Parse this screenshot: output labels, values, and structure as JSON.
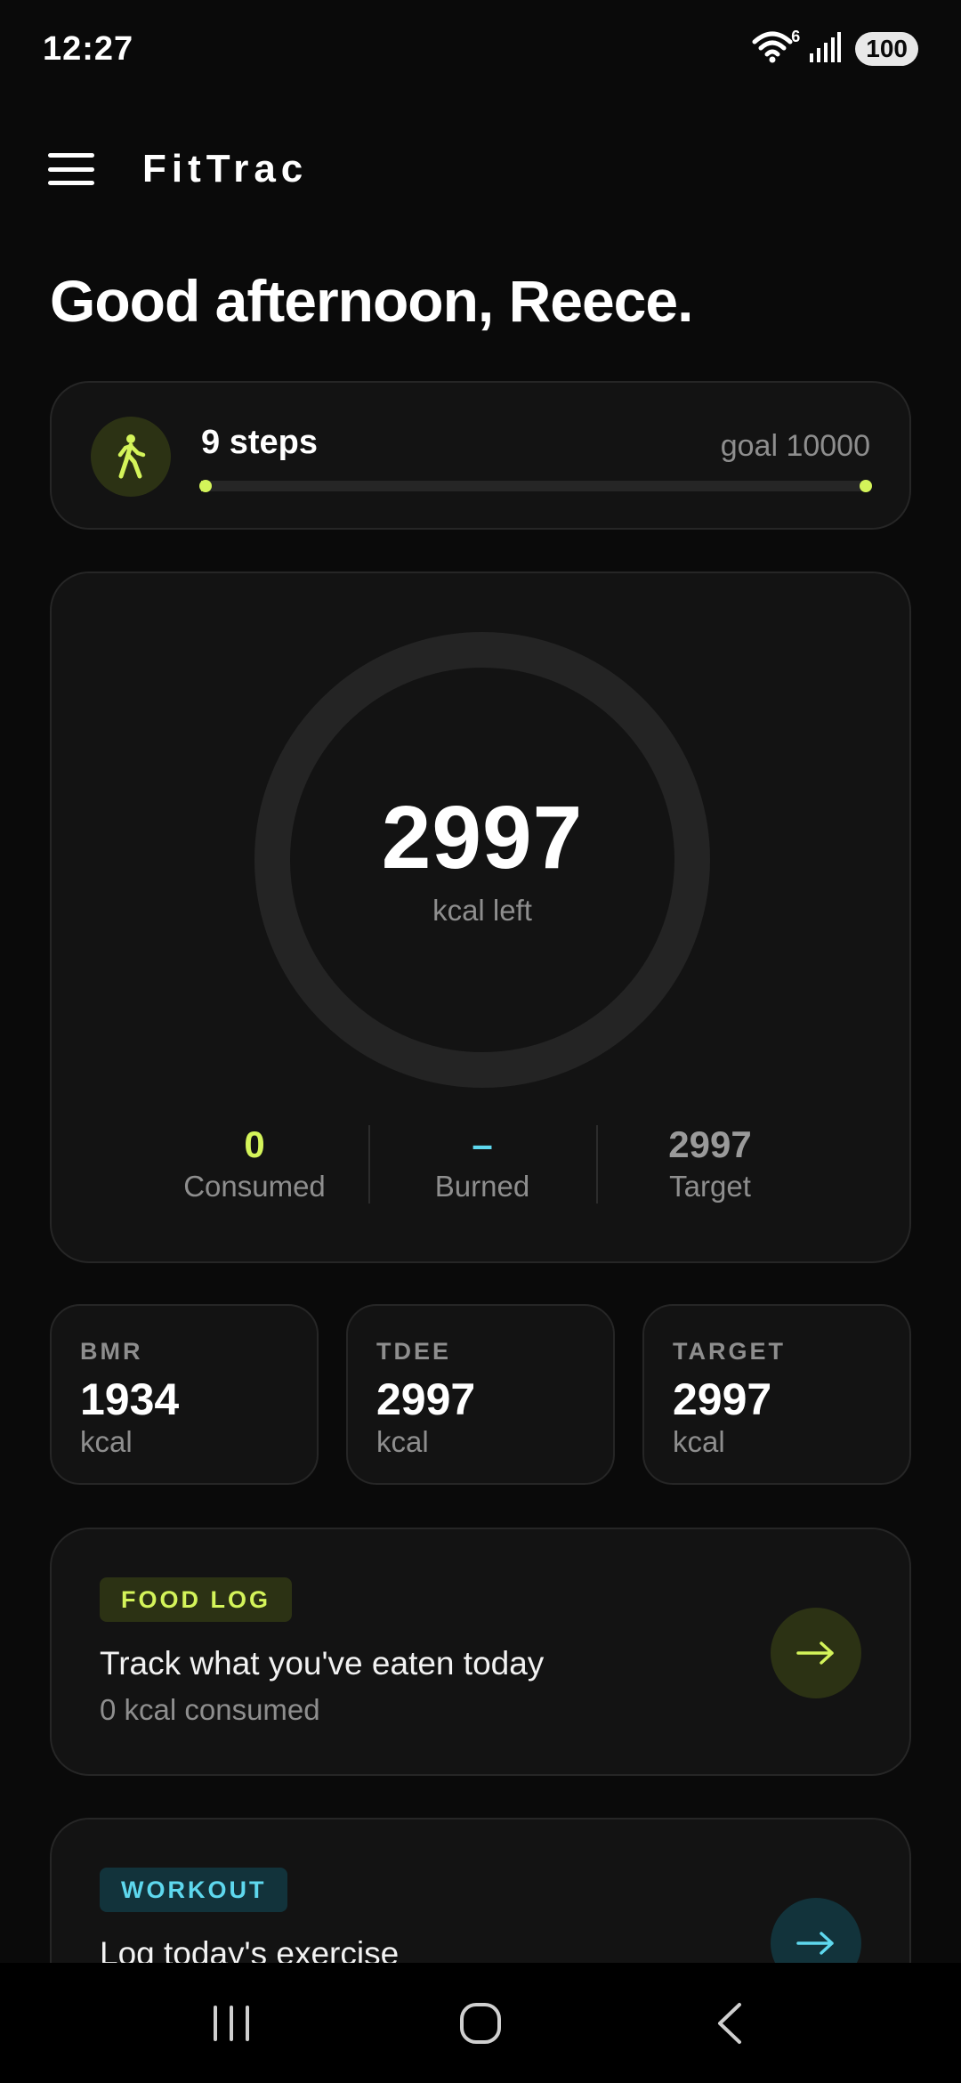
{
  "status": {
    "time": "12:27",
    "wifi_badge": "6",
    "battery": "100"
  },
  "app": {
    "title": "FitTrac"
  },
  "greeting": "Good afternoon, Reece.",
  "steps": {
    "count_label": "9 steps",
    "goal_label": "goal 10000",
    "progress": 0.0009,
    "accent": "#d4f45a"
  },
  "calories": {
    "left_value": "2997",
    "left_label": "kcal left",
    "ring_progress": 0,
    "stats": [
      {
        "value": "0",
        "label": "Consumed",
        "color": "#d4f45a"
      },
      {
        "value": "–",
        "label": "Burned",
        "color": "#5ed8ee"
      },
      {
        "value": "2997",
        "label": "Target",
        "color": "#9a9a9a"
      }
    ]
  },
  "metrics": [
    {
      "label": "BMR",
      "value": "1934",
      "unit": "kcal"
    },
    {
      "label": "TDEE",
      "value": "2997",
      "unit": "kcal"
    },
    {
      "label": "TARGET",
      "value": "2997",
      "unit": "kcal"
    }
  ],
  "actions": {
    "food": {
      "badge": "FOOD LOG",
      "title": "Track what you've eaten today",
      "subtitle": "0 kcal consumed",
      "accent": "#d4f45a",
      "arrow": "→"
    },
    "workout": {
      "badge": "WORKOUT",
      "title": "Log today's exercise",
      "accent": "#5ed8ee",
      "arrow": "→"
    }
  },
  "icons": {
    "menu": "hamburger-icon",
    "steps": "walking-icon",
    "nav_recents": "recents-icon",
    "nav_home": "home-icon",
    "nav_back": "back-icon"
  }
}
